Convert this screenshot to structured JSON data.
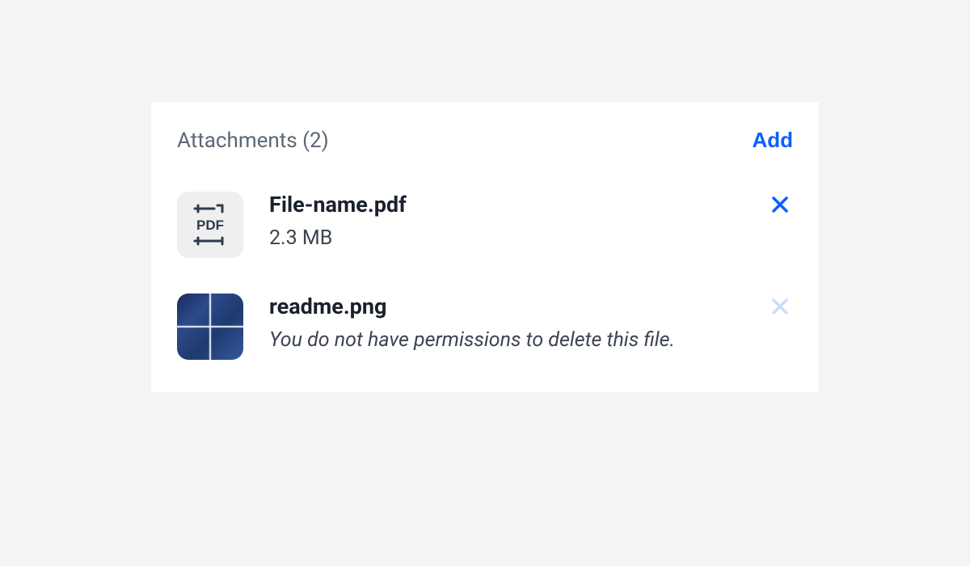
{
  "header": {
    "title": "Attachments (2)",
    "add_label": "Add"
  },
  "files": [
    {
      "icon_type": "pdf",
      "name": "File-name.pdf",
      "meta": "2.3 MB",
      "deletable": true
    },
    {
      "icon_type": "image",
      "name": "readme.png",
      "meta": "You do not have permissions to delete this file.",
      "deletable": false
    }
  ]
}
